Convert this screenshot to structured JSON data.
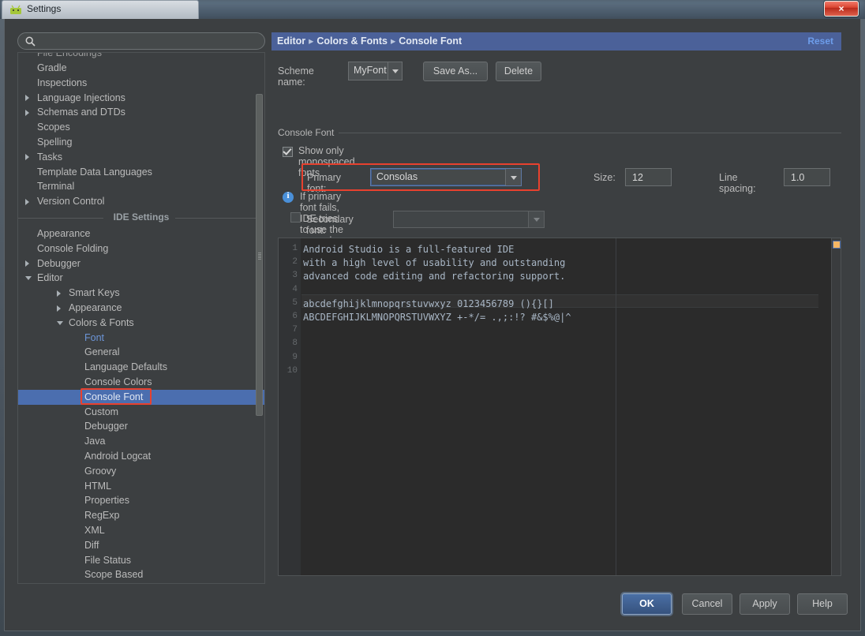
{
  "window": {
    "title": "Settings",
    "app_icon": "android-studio-icon",
    "close_label": "×"
  },
  "search": {
    "value": "",
    "placeholder": "",
    "icon": "search-icon"
  },
  "sidebar": {
    "items": [
      {
        "label": "File Encodings",
        "indent": 24,
        "arrow": "none",
        "clipped": true
      },
      {
        "label": "Gradle",
        "indent": 24,
        "arrow": "none"
      },
      {
        "label": "Inspections",
        "indent": 24,
        "arrow": "none"
      },
      {
        "label": "Language Injections",
        "indent": 24,
        "arrow": "closed"
      },
      {
        "label": "Schemas and DTDs",
        "indent": 24,
        "arrow": "closed"
      },
      {
        "label": "Scopes",
        "indent": 24,
        "arrow": "none"
      },
      {
        "label": "Spelling",
        "indent": 24,
        "arrow": "none"
      },
      {
        "label": "Tasks",
        "indent": 24,
        "arrow": "closed"
      },
      {
        "label": "Template Data Languages",
        "indent": 24,
        "arrow": "none"
      },
      {
        "label": "Terminal",
        "indent": 24,
        "arrow": "none"
      },
      {
        "label": "Version Control",
        "indent": 24,
        "arrow": "closed"
      }
    ],
    "separator_label": "IDE Settings",
    "items2": [
      {
        "label": "Appearance",
        "indent": 24,
        "arrow": "none"
      },
      {
        "label": "Console Folding",
        "indent": 24,
        "arrow": "none"
      },
      {
        "label": "Debugger",
        "indent": 24,
        "arrow": "closed"
      },
      {
        "label": "Editor",
        "indent": 24,
        "arrow": "open"
      },
      {
        "label": "Smart Keys",
        "indent": 64,
        "arrow": "closed"
      },
      {
        "label": "Appearance",
        "indent": 64,
        "arrow": "closed"
      },
      {
        "label": "Colors & Fonts",
        "indent": 64,
        "arrow": "open"
      },
      {
        "label": "Font",
        "indent": 84,
        "arrow": "none",
        "style": "blue"
      },
      {
        "label": "General",
        "indent": 84,
        "arrow": "none"
      },
      {
        "label": "Language Defaults",
        "indent": 84,
        "arrow": "none"
      },
      {
        "label": "Console Colors",
        "indent": 84,
        "arrow": "none"
      },
      {
        "label": "Console Font",
        "indent": 84,
        "arrow": "none",
        "selected": true,
        "highlight": true
      },
      {
        "label": "Custom",
        "indent": 84,
        "arrow": "none"
      },
      {
        "label": "Debugger",
        "indent": 84,
        "arrow": "none"
      },
      {
        "label": "Java",
        "indent": 84,
        "arrow": "none"
      },
      {
        "label": "Android Logcat",
        "indent": 84,
        "arrow": "none"
      },
      {
        "label": "Groovy",
        "indent": 84,
        "arrow": "none"
      },
      {
        "label": "HTML",
        "indent": 84,
        "arrow": "none"
      },
      {
        "label": "Properties",
        "indent": 84,
        "arrow": "none"
      },
      {
        "label": "RegExp",
        "indent": 84,
        "arrow": "none"
      },
      {
        "label": "XML",
        "indent": 84,
        "arrow": "none"
      },
      {
        "label": "Diff",
        "indent": 84,
        "arrow": "none"
      },
      {
        "label": "File Status",
        "indent": 84,
        "arrow": "none"
      },
      {
        "label": "Scope Based",
        "indent": 84,
        "arrow": "none"
      }
    ]
  },
  "breadcrumb": {
    "parts": [
      "Editor",
      "Colors & Fonts",
      "Console Font"
    ],
    "separator": "▸",
    "reset_label": "Reset"
  },
  "scheme": {
    "label": "Scheme name:",
    "value": "MyFont",
    "save_as_label": "Save As...",
    "delete_label": "Delete"
  },
  "console_font": {
    "group_title": "Console Font",
    "show_monospaced_label": "Show only monospaced fonts",
    "show_monospaced_checked": true,
    "primary_font_label": "Primary font:",
    "primary_font_value": "Consolas",
    "size_label": "Size:",
    "size_value": "12",
    "line_spacing_label": "Line spacing:",
    "line_spacing_value": "1.0",
    "info_text": "If primary font fails, IDE tries to use the secondary one",
    "secondary_font_label": "Secondary font:",
    "secondary_font_value": "",
    "secondary_font_checked": false
  },
  "preview": {
    "line_numbers": [
      "1",
      "2",
      "3",
      "4",
      "5",
      "6",
      "7",
      "8",
      "9",
      "10"
    ],
    "lines": [
      "Android Studio is a full-featured IDE",
      "with a high level of usability and outstanding",
      "advanced code editing and refactoring support.",
      "",
      "abcdefghijklmnopqrstuvwxyz 0123456789 (){}[]",
      "ABCDEFGHIJKLMNOPQRSTUVWXYZ +-*/= .,;:!? #&$%@|^"
    ],
    "stripe_marker_color": "#f5b664"
  },
  "dialog_buttons": {
    "ok": "OK",
    "cancel": "Cancel",
    "apply": "Apply",
    "help": "Help"
  },
  "colors": {
    "accent_blue": "#4b6199",
    "selection_blue": "#4b6eaf",
    "highlight_red": "#e8412e",
    "link_blue": "#6d9dea",
    "marker_orange": "#f5b664"
  }
}
